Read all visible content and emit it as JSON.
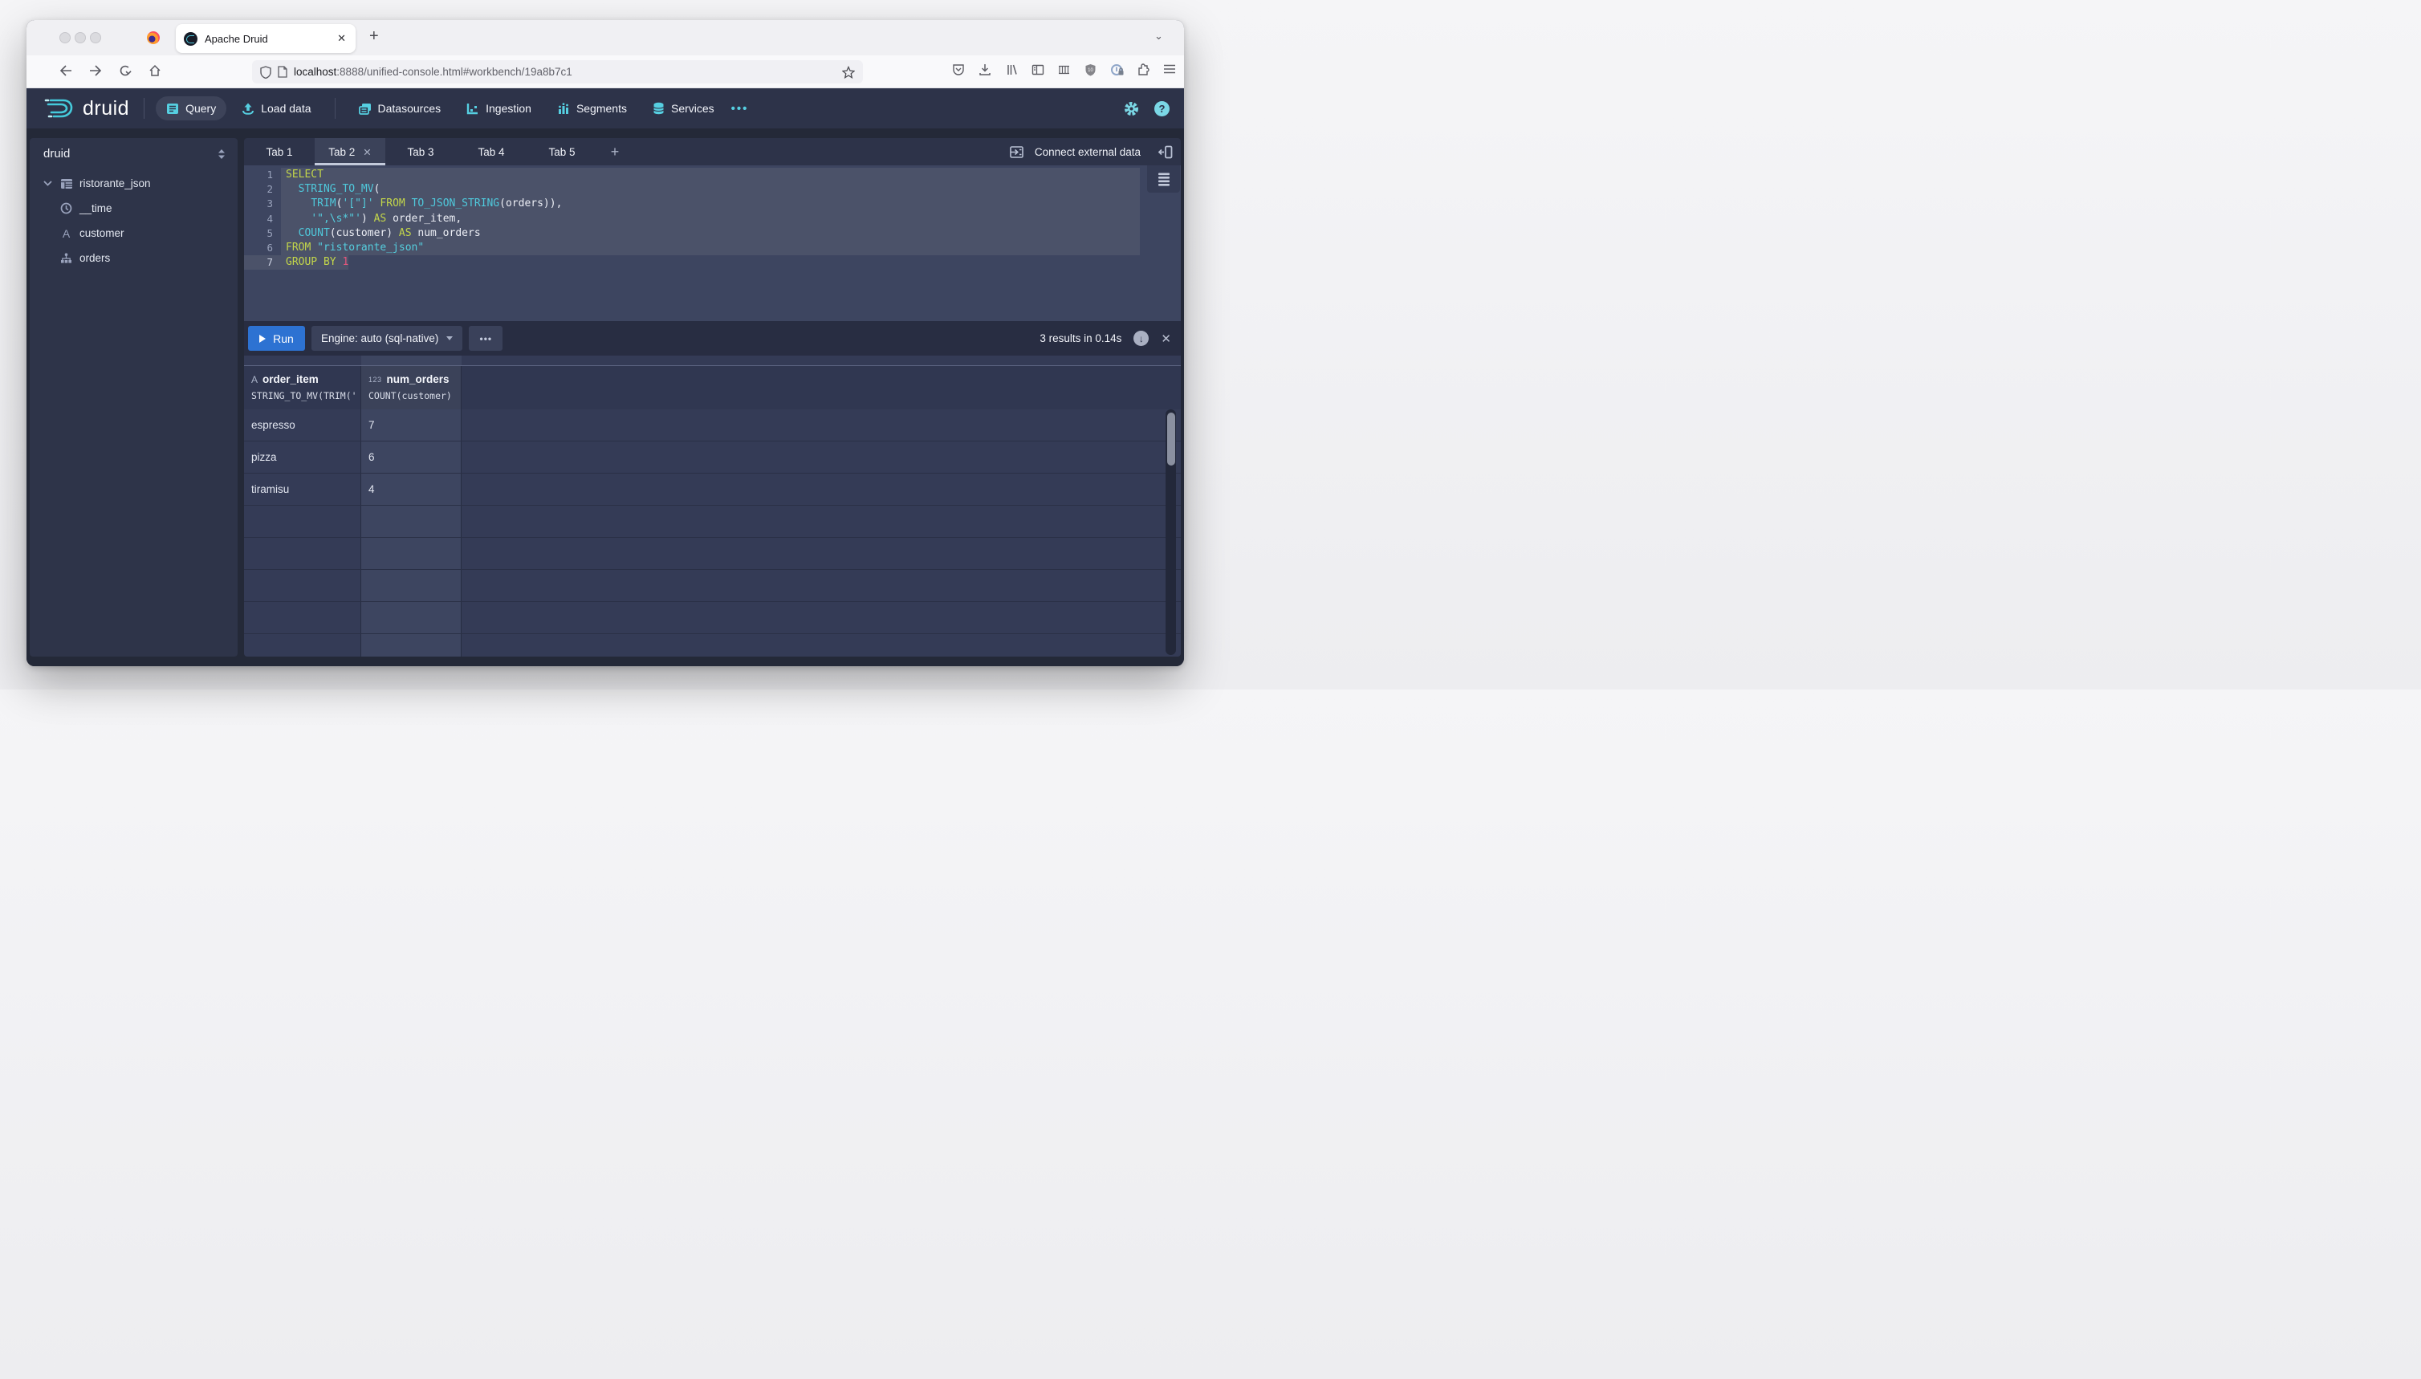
{
  "browser": {
    "tab_title": "Apache Druid",
    "tab_close": "✕",
    "new_tab": "+",
    "url_host": "localhost",
    "url_rest": ":8888/unified-console.html#workbench/19a8b7c1",
    "toolbar_icons": [
      "pocket-icon",
      "download-icon",
      "library-icon",
      "sidebar-icon",
      "containers-icon",
      "shield-badge-icon",
      "privacy-lock-icon",
      "extension-icon",
      "menu-icon"
    ]
  },
  "header": {
    "logo_text": "druid",
    "nav": [
      {
        "id": "query",
        "label": "Query",
        "icon": "query-icon",
        "active": true
      },
      {
        "id": "load-data",
        "label": "Load data",
        "icon": "load-data-icon",
        "active": false
      },
      {
        "id": "datasources",
        "label": "Datasources",
        "icon": "datasources-icon",
        "active": false,
        "sep_before": true
      },
      {
        "id": "ingestion",
        "label": "Ingestion",
        "icon": "ingestion-icon",
        "active": false
      },
      {
        "id": "segments",
        "label": "Segments",
        "icon": "segments-icon",
        "active": false
      },
      {
        "id": "services",
        "label": "Services",
        "icon": "services-icon",
        "active": false
      }
    ],
    "overflow_dots": "•••",
    "help_glyph": "?"
  },
  "sidebar": {
    "schema": "druid",
    "tree": [
      {
        "label": "ristorante_json",
        "icon": "table-icon",
        "parent": true
      },
      {
        "label": "__time",
        "icon": "clock-icon",
        "parent": false
      },
      {
        "label": "customer",
        "icon": "string-type-icon",
        "parent": false
      },
      {
        "label": "orders",
        "icon": "nested-data-icon",
        "parent": false
      }
    ]
  },
  "workbench": {
    "tabs": [
      {
        "label": "Tab 1",
        "active": false
      },
      {
        "label": "Tab 2",
        "active": true,
        "close": "✕"
      },
      {
        "label": "Tab 3",
        "active": false
      },
      {
        "label": "Tab 4",
        "active": false
      },
      {
        "label": "Tab 5",
        "active": false
      }
    ],
    "add_tab": "+",
    "connect_label": "Connect external data",
    "run_label": "Run",
    "engine_label": "Engine: auto (sql-native)",
    "more_dots": "•••",
    "results_status": "3 results in 0.14s",
    "download_glyph": "↓",
    "close_glyph": "✕"
  },
  "editor": {
    "code_lines": [
      {
        "n": "1",
        "tokens": [
          {
            "t": "SELECT",
            "c": "kw"
          }
        ]
      },
      {
        "n": "2",
        "tokens": [
          {
            "t": "  ",
            "c": "pl"
          },
          {
            "t": "STRING_TO_MV",
            "c": "fn"
          },
          {
            "t": "(",
            "c": "pl"
          }
        ]
      },
      {
        "n": "3",
        "tokens": [
          {
            "t": "    ",
            "c": "pl"
          },
          {
            "t": "TRIM",
            "c": "fn"
          },
          {
            "t": "(",
            "c": "pl"
          },
          {
            "t": "'[\"]'",
            "c": "str"
          },
          {
            "t": " ",
            "c": "pl"
          },
          {
            "t": "FROM",
            "c": "kw"
          },
          {
            "t": " ",
            "c": "pl"
          },
          {
            "t": "TO_JSON_STRING",
            "c": "fn"
          },
          {
            "t": "(orders)),",
            "c": "pl"
          }
        ]
      },
      {
        "n": "4",
        "tokens": [
          {
            "t": "    ",
            "c": "pl"
          },
          {
            "t": "'\",\\s*\"'",
            "c": "str"
          },
          {
            "t": ") ",
            "c": "pl"
          },
          {
            "t": "AS",
            "c": "kw"
          },
          {
            "t": " order_item,",
            "c": "pl"
          }
        ]
      },
      {
        "n": "5",
        "tokens": [
          {
            "t": "  ",
            "c": "pl"
          },
          {
            "t": "COUNT",
            "c": "fn"
          },
          {
            "t": "(customer) ",
            "c": "pl"
          },
          {
            "t": "AS",
            "c": "kw"
          },
          {
            "t": " num_orders",
            "c": "pl"
          }
        ]
      },
      {
        "n": "6",
        "tokens": [
          {
            "t": "FROM",
            "c": "kw"
          },
          {
            "t": " ",
            "c": "pl"
          },
          {
            "t": "\"ristorante_json\"",
            "c": "str"
          }
        ]
      },
      {
        "n": "7",
        "tokens": [
          {
            "t": "GROUP BY",
            "c": "kw"
          },
          {
            "t": " ",
            "c": "pl"
          },
          {
            "t": "1",
            "c": "num"
          }
        ]
      }
    ],
    "active_line": "7"
  },
  "results_table": {
    "columns": [
      {
        "name": "order_item",
        "type_badge": "A",
        "expr": "STRING_TO_MV(TRIM('[…"
      },
      {
        "name": "num_orders",
        "type_badge": "123",
        "expr": "COUNT(customer)"
      }
    ],
    "rows": [
      {
        "order_item": "espresso",
        "num_orders": "7"
      },
      {
        "order_item": "pizza",
        "num_orders": "6"
      },
      {
        "order_item": "tiramisu",
        "num_orders": "4"
      }
    ],
    "empty_rows": 6
  },
  "colors": {
    "accent_cyan": "#56cfe1",
    "run_blue": "#2d72d2",
    "keyword": "#c3d64a",
    "function": "#4fc9dc",
    "number": "#e4567c",
    "panel_bg": "#2d3349",
    "editor_bg": "#3d4560",
    "highlight_bg": "#4b5269"
  }
}
